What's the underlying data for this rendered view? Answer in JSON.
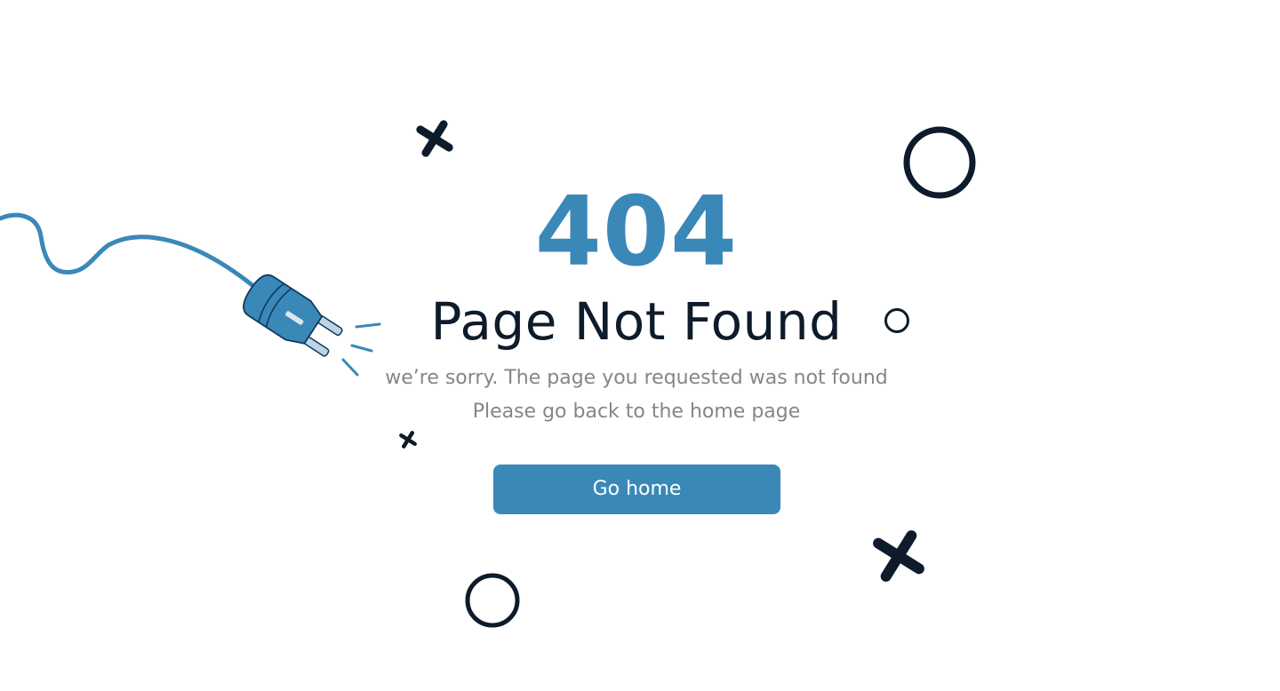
{
  "error": {
    "code": "404",
    "title": "Page Not Found",
    "message_line1": "we’re sorry. The page you requested was not found",
    "message_line2": "Please go back to the home page"
  },
  "actions": {
    "home_button_label": "Go home"
  },
  "colors": {
    "accent": "#3A88B8",
    "dark": "#0D1B2A",
    "muted_text": "#868686",
    "background": "#FFFFFF"
  },
  "icons": [
    "unplugged-plug-icon",
    "cross-icon",
    "ring-icon"
  ]
}
